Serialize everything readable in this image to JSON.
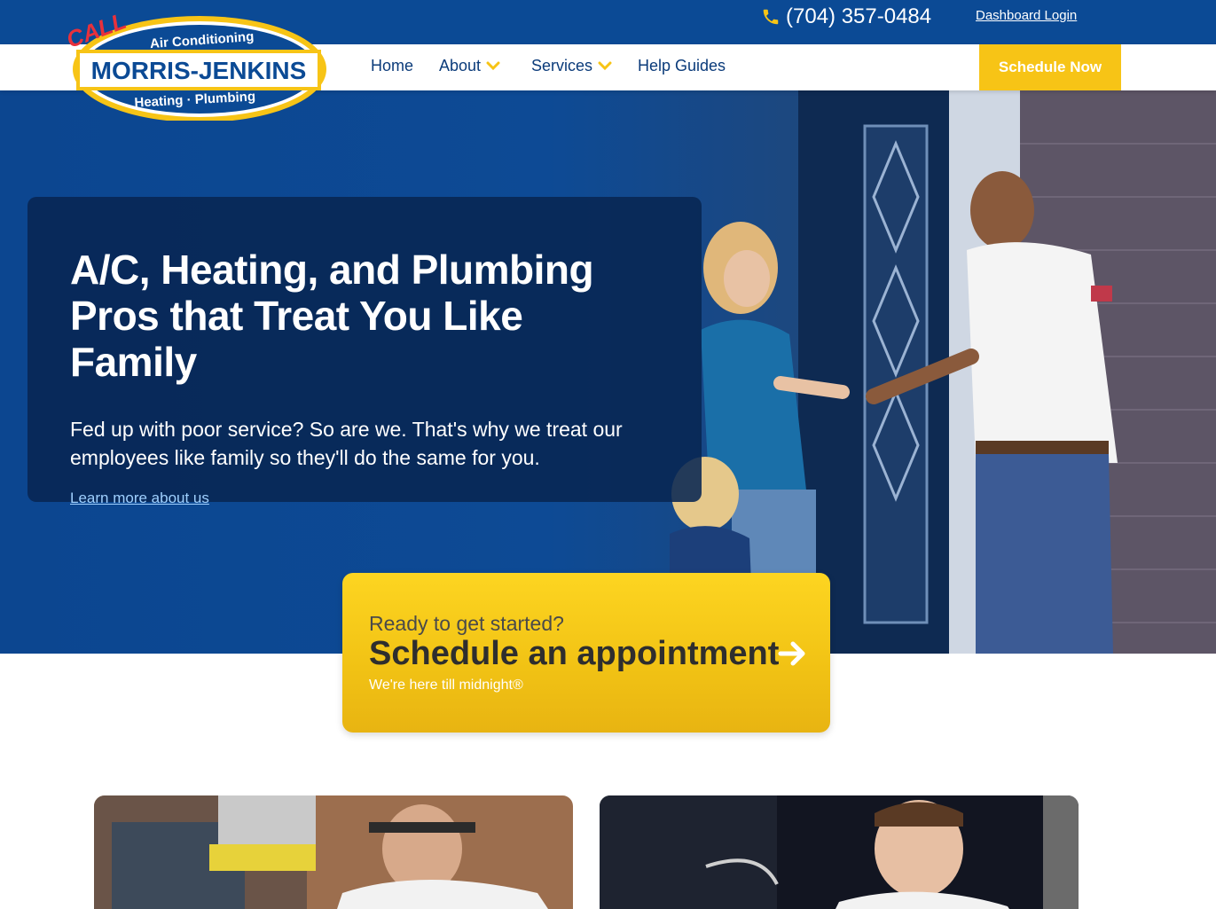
{
  "header": {
    "phone": "(704) 357-0484",
    "dashboard_login": "Dashboard Login",
    "logo": {
      "call": "CALL",
      "brand": "MORRIS-JENKINS",
      "top_line": "Air Conditioning",
      "bottom_line": "Heating · Plumbing"
    }
  },
  "nav": {
    "items": [
      {
        "label": "Home"
      },
      {
        "label": "About"
      },
      {
        "label": "Services"
      },
      {
        "label": "Help Guides"
      }
    ],
    "schedule_now": "Schedule Now"
  },
  "hero": {
    "title_line1": "A/C, Heating, and Plumbing",
    "title_line2": "Pros that Treat You Like Family",
    "subtitle_line1": "Fed up with poor service? So are we. That's why we treat our",
    "subtitle_line2": "employees like family so they'll do the same for you.",
    "link": "Learn more about us"
  },
  "appointment": {
    "pre": "Ready to get started?",
    "main": "Schedule an appointment",
    "note": "We're here till midnight®"
  },
  "colors": {
    "brand_blue": "#0b4a95",
    "accent_yellow": "#f7c416",
    "navy_card": "#082552",
    "logo_red": "#e8313c"
  },
  "icons": [
    "phone-icon",
    "chevron-down-icon",
    "arrow-right-icon"
  ]
}
